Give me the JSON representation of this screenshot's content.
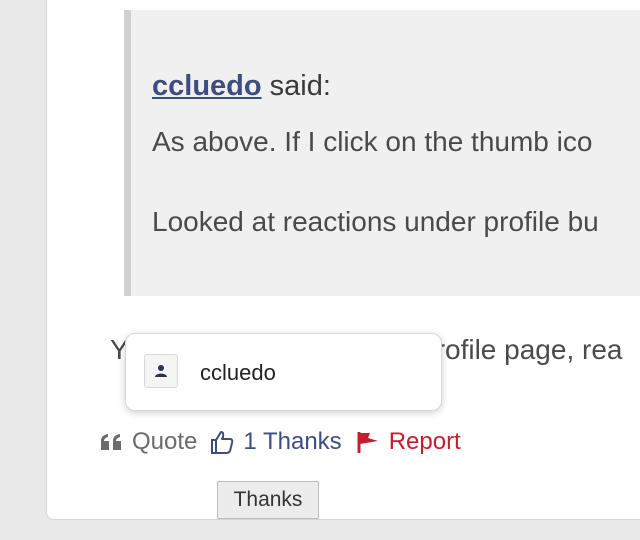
{
  "post": {
    "quote": {
      "author": "ccluedo",
      "said": "said:",
      "line1": "As above. If I click on the thumb ico",
      "line2": "Looked at reactions under profile bu"
    },
    "reply_start": "Y",
    "reply_end": "rofile page, rea"
  },
  "reactions_popup": {
    "users": [
      {
        "name": "ccluedo",
        "avatar_icon": "user-silhouette-icon"
      }
    ]
  },
  "actions": {
    "quote_label": "Quote",
    "quote_icon": "quote-marks-icon",
    "thanks_label": "1 Thanks",
    "thanks_icon": "thumbs-up-icon",
    "report_label": "Report",
    "report_icon": "flag-icon"
  },
  "tooltip": {
    "text": "Thanks"
  },
  "colors": {
    "link": "#3d4d80",
    "report": "#c41f2f",
    "quote_bg": "#f0f0f0",
    "quote_border": "#d0d0d0"
  }
}
